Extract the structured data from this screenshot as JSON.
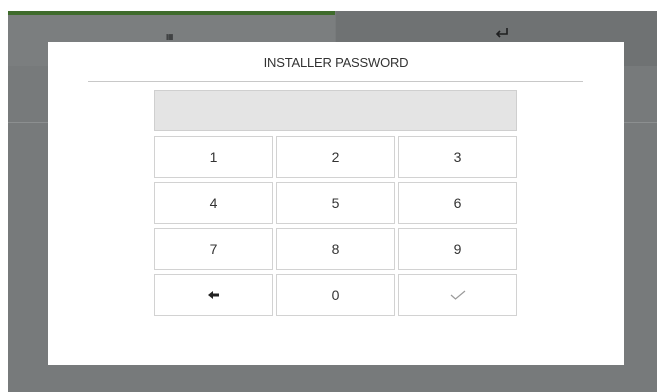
{
  "modal": {
    "title": "INSTALLER PASSWORD",
    "password_value": ""
  },
  "keypad": {
    "keys": [
      "1",
      "2",
      "3",
      "4",
      "5",
      "6",
      "7",
      "8",
      "9",
      "",
      "0",
      ""
    ],
    "backspace_icon": "backspace-arrow-icon",
    "confirm_icon": "checkmark-icon"
  },
  "background": {
    "left_tab_icon": "grid-icon",
    "right_tab_icon": "return-arrow-icon",
    "active_tab_color": "#3f6b2c"
  }
}
